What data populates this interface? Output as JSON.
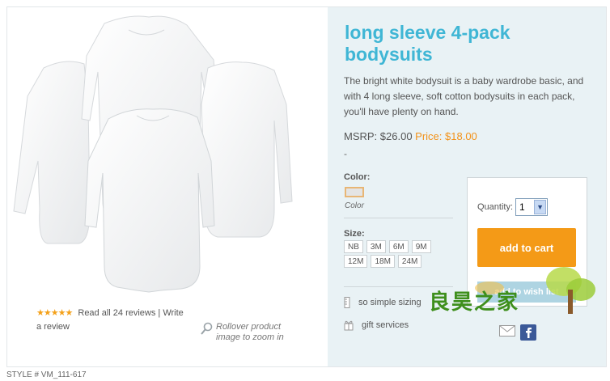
{
  "product": {
    "title": "long sleeve 4-pack bodysuits",
    "description": "The bright white bodysuit is a baby wardrobe basic, and with 4 long sleeve, soft cotton bodysuits in each pack, you'll have plenty on hand.",
    "msrp_label": "MSRP: $26.00",
    "price_label": "Price: $18.00",
    "dash": "-",
    "style": "STYLE # VM_111-617"
  },
  "reviews": {
    "stars": "★★★★★",
    "rating": 5,
    "text_line1": "Read all 24 reviews | Write",
    "text_line2": "a review"
  },
  "zoom": {
    "line1": "Rollover product",
    "line2": "image to zoom in"
  },
  "options": {
    "color_label": "Color:",
    "color_name": "Color",
    "size_label": "Size:",
    "sizes": [
      "NB",
      "3M",
      "6M",
      "9M",
      "12M",
      "18M",
      "24M"
    ]
  },
  "cart": {
    "quantity_label": "Quantity:",
    "quantity_value": "1",
    "add_to_cart": "add to cart",
    "add_to_wishlist": "add to wish list"
  },
  "links": {
    "sizing": "so simple sizing",
    "gift": "gift services"
  },
  "watermark": {
    "text": "良昊之家"
  },
  "colors": {
    "accent_blue": "#3fb6d5",
    "sale_orange": "#f29219",
    "button_orange": "#f49a17",
    "panel_bg": "#e9f2f5",
    "star": "#f4a11a"
  }
}
